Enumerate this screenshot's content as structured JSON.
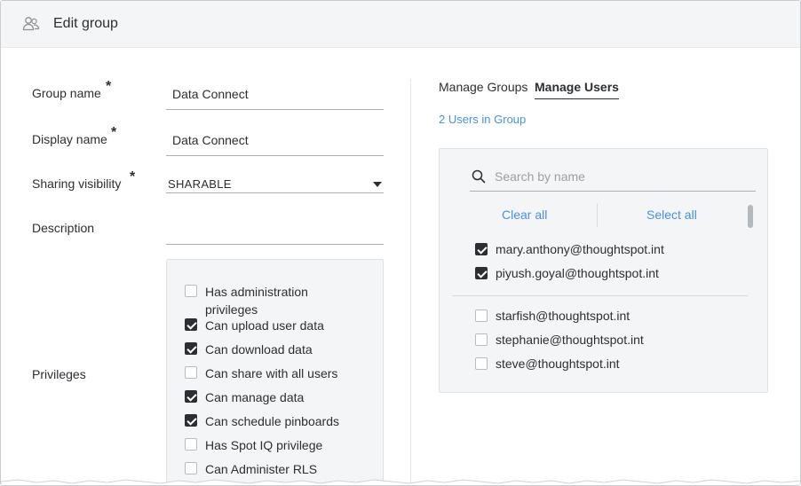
{
  "dialog": {
    "title": "Edit group",
    "icon": "user-group-icon"
  },
  "form": {
    "group_name": {
      "label": "Group name",
      "required_mark": "*",
      "value": "Data Connect"
    },
    "display_name": {
      "label": "Display name",
      "required_mark": "*",
      "value": "Data Connect"
    },
    "sharing_visibility": {
      "label": "Sharing visibility",
      "required_mark": "*",
      "value": "SHARABLE"
    },
    "description": {
      "label": "Description",
      "value": ""
    },
    "privileges": {
      "label": "Privileges",
      "items": [
        {
          "label": "Has administration privileges",
          "checked": false
        },
        {
          "label": "Can upload user data",
          "checked": true
        },
        {
          "label": "Can download data",
          "checked": true
        },
        {
          "label": "Can share with all users",
          "checked": false
        },
        {
          "label": "Can manage data",
          "checked": true
        },
        {
          "label": "Can schedule pinboards",
          "checked": true
        },
        {
          "label": "Has Spot IQ privilege",
          "checked": false
        },
        {
          "label": "Can Administer RLS",
          "checked": false
        }
      ]
    }
  },
  "right_panel": {
    "tabs": [
      {
        "label": "Manage Groups",
        "active": false
      },
      {
        "label": "Manage Users",
        "active": true
      }
    ],
    "count_text": "2 Users in Group",
    "search": {
      "placeholder": "Search by name",
      "value": ""
    },
    "clear_all": "Clear all",
    "select_all": "Select all",
    "selected_users": [
      {
        "email": "mary.anthony@thoughtspot.int",
        "checked": true
      },
      {
        "email": "piyush.goyal@thoughtspot.int",
        "checked": true
      }
    ],
    "other_users": [
      {
        "email": "starfish@thoughtspot.int",
        "checked": false
      },
      {
        "email": "stephanie@thoughtspot.int",
        "checked": false
      },
      {
        "email": "steve@thoughtspot.int",
        "checked": false
      }
    ]
  },
  "colors": {
    "accent_link": "#4a90e2",
    "header_bg": "#f4f5f6",
    "text": "#2b2f33",
    "checkbox_checked": "#2b2f33"
  }
}
